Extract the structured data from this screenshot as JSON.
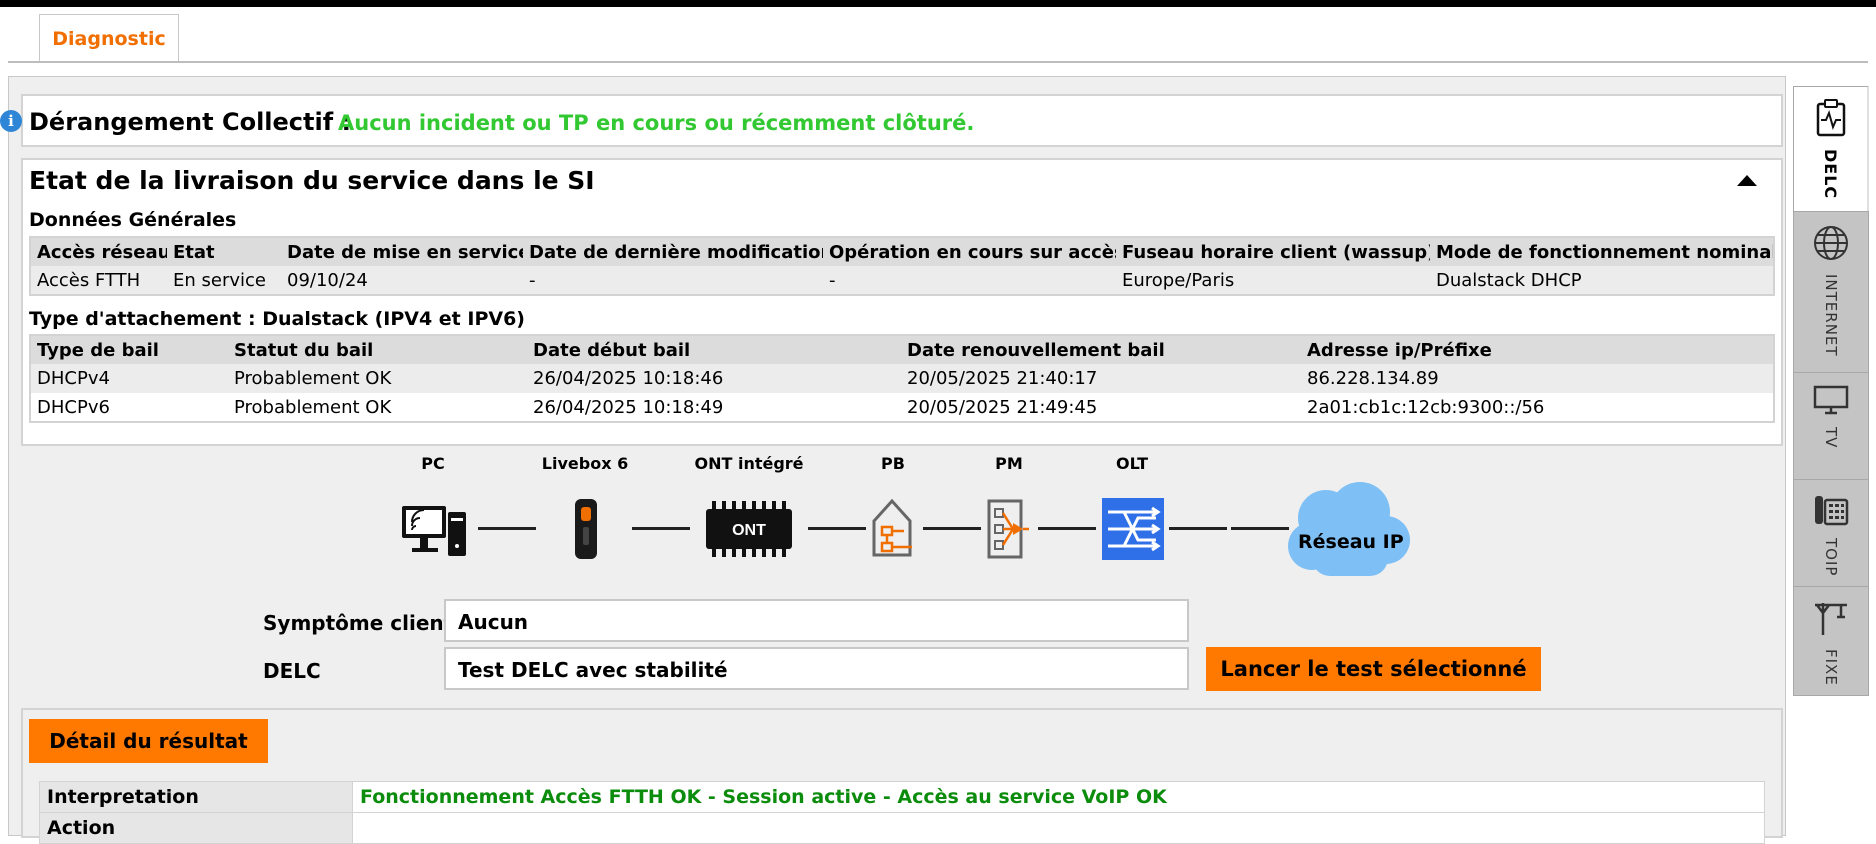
{
  "tabs": {
    "active_label": "Diagnostic"
  },
  "derangement": {
    "title": "Dérangement Collectif :",
    "status": "Aucun incident ou TP en cours ou récemment clôturé."
  },
  "service_delivery": {
    "title": "Etat de la livraison du service dans le SI",
    "general": {
      "title": "Données Générales",
      "headers": [
        "Accès réseau",
        "Etat",
        "Date de mise en service",
        "Date de dernière modification",
        "Opération en cours sur accès",
        "Fuseau horaire client (wassup)",
        "Mode de fonctionnement nominal"
      ],
      "row": [
        "Accès FTTH",
        "En service",
        "09/10/24",
        "-",
        "-",
        "Europe/Paris",
        "Dualstack DHCP"
      ]
    },
    "attachment": {
      "title": "Type d'attachement : Dualstack (IPV4 et IPV6)",
      "headers": [
        "Type de bail",
        "Statut du bail",
        "Date début bail",
        "Date renouvellement bail",
        "Adresse ip/Préfixe"
      ],
      "rows": [
        [
          "DHCPv4",
          "Probablement OK",
          "26/04/2025 10:18:46",
          "20/05/2025 21:40:17",
          "86.228.134.89"
        ],
        [
          "DHCPv6",
          "Probablement OK",
          "26/04/2025 10:18:49",
          "20/05/2025 21:49:45",
          "2a01:cb1c:12cb:9300::/56"
        ]
      ]
    }
  },
  "topology": {
    "labels": [
      "PC",
      "Livebox 6",
      "ONT intégré",
      "PB",
      "PM",
      "OLT"
    ],
    "ont_text": "ONT",
    "cloud_label": "Réseau IP",
    "colors": {
      "olt": "#2f6fe8",
      "pb_pm_accent": "#f16e00",
      "cloud": "#7ec0f5"
    }
  },
  "form": {
    "symptom_label": "Symptôme client",
    "symptom_value": "Aucun",
    "delc_label": "DELC",
    "delc_value": "Test DELC avec stabilité",
    "launch_button": "Lancer le test sélectionné"
  },
  "result": {
    "button": "Détail du résultat",
    "rows": [
      {
        "key": "Interpretation",
        "value": "Fonctionnement Accès FTTH OK - Session active - Accès au service VoIP OK"
      },
      {
        "key": "Action",
        "value": ""
      }
    ]
  },
  "sidebar": {
    "items": [
      {
        "label": "DELC",
        "icon": "clipboard-pulse-icon",
        "active": true
      },
      {
        "label": "INTERNET",
        "icon": "globe-icon",
        "active": false
      },
      {
        "label": "TV",
        "icon": "monitor-icon",
        "active": false
      },
      {
        "label": "TOIP",
        "icon": "phone-icon",
        "active": false
      },
      {
        "label": "FIXE",
        "icon": "pole-icon",
        "active": false
      }
    ]
  },
  "colors": {
    "brand": "#ff7900",
    "ok_green": "#32c832",
    "result_green": "#0c8c0c"
  }
}
